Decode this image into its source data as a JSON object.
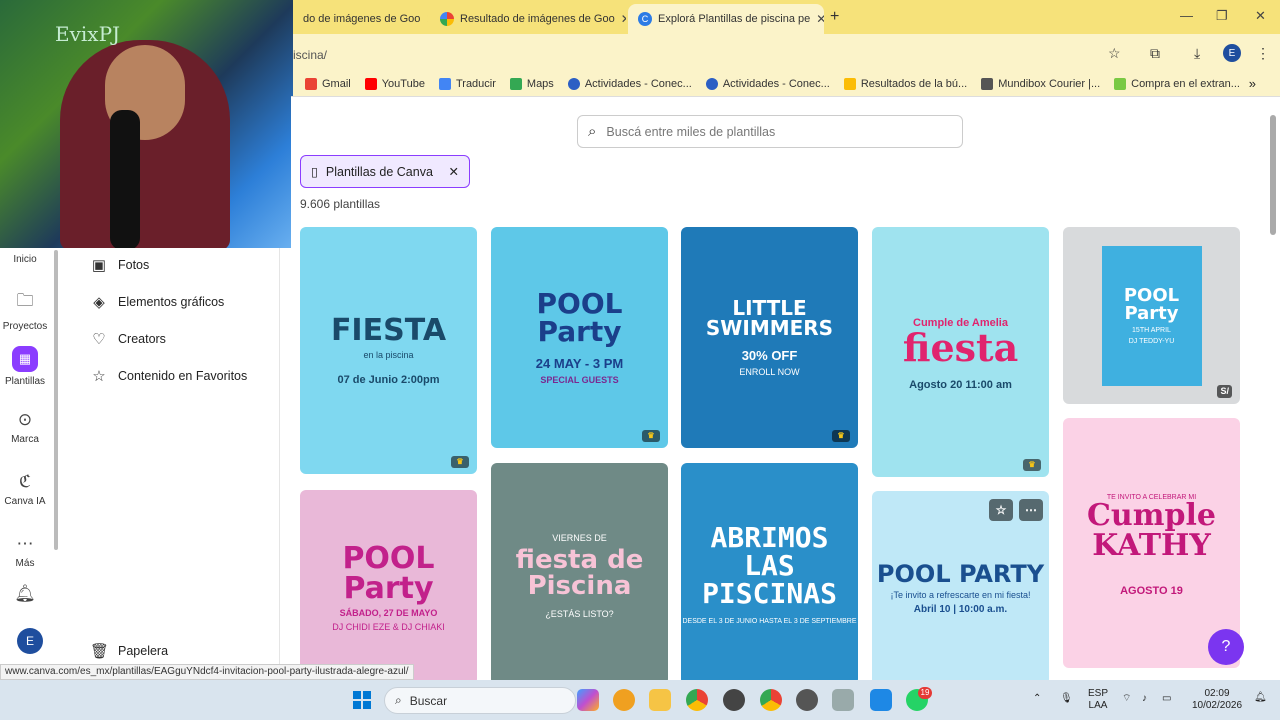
{
  "browser": {
    "tabs": [
      {
        "label": "do de imágenes de Goo",
        "icon": "google-icon"
      },
      {
        "label": "Resultado de imágenes de Goo",
        "icon": "google-icon"
      },
      {
        "label": "Explorá Plantillas de piscina pe",
        "icon": "canva-icon",
        "active": true
      }
    ],
    "new_tab": "+",
    "url": "iscina/",
    "bookmarks": [
      {
        "label": "Gmail",
        "color": "#ea4335"
      },
      {
        "label": "YouTube",
        "color": "#ff0000"
      },
      {
        "label": "Traducir",
        "color": "#4285f4"
      },
      {
        "label": "Maps",
        "color": "#34a853"
      },
      {
        "label": "Actividades - Conec...",
        "color": "#2c5fc4"
      },
      {
        "label": "Actividades - Conec...",
        "color": "#2c5fc4"
      },
      {
        "label": "Resultados de la bú...",
        "color": "#fbbc05"
      },
      {
        "label": "Mundibox Courier |...",
        "color": "#555555"
      },
      {
        "label": "Compra en el extran...",
        "color": "#7ac943"
      }
    ],
    "profile_initial": "E"
  },
  "webcam": {
    "overlay_text": "EvixPJ"
  },
  "rail": {
    "items": [
      {
        "label": "Inicio",
        "icon": "home-icon"
      },
      {
        "label": "Proyectos",
        "icon": "folder-icon"
      },
      {
        "label": "Plantillas",
        "icon": "templates-icon",
        "active": true
      },
      {
        "label": "Marca",
        "icon": "brand-icon"
      },
      {
        "label": "Canva IA",
        "icon": "canva-ai-icon"
      },
      {
        "label": "Más",
        "icon": "more-icon"
      }
    ],
    "user_initial": "E"
  },
  "sidemenu": {
    "items": [
      {
        "label": "Fotos",
        "icon": "photo-icon"
      },
      {
        "label": "Elementos gráficos",
        "icon": "shapes-icon"
      },
      {
        "label": "Creators",
        "icon": "creators-icon"
      },
      {
        "label": "Contenido en Favoritos",
        "icon": "star-icon"
      }
    ],
    "trash": "Papelera"
  },
  "main": {
    "search_placeholder": "Buscá entre miles de plantillas",
    "filter_chip": "Plantillas de Canva",
    "count": "9.606 plantillas",
    "cards": [
      {
        "title": "FIESTA",
        "sub": "en la piscina",
        "detail": "07 de Junio 2:00pm",
        "bg": "#7fd8f0",
        "fg": "#1a4a6a"
      },
      {
        "title": "POOL Party",
        "sub": "24 MAY - 3 PM",
        "detail": "SPECIAL GUESTS",
        "bg": "#5ec8e8",
        "fg": "#1b3f8a"
      },
      {
        "title": "LITTLE SWIMMERS",
        "sub": "30% OFF",
        "detail": "ENROLL NOW",
        "bg": "#1f7ab8",
        "fg": "#ffffff"
      },
      {
        "title": "fiesta",
        "sub": "Cumple de Amelia",
        "detail": "Agosto 20 11:00 am",
        "bg": "#9fe3ef",
        "fg": "#e0246e"
      },
      {
        "title": "POOL Party",
        "sub": "15TH APRIL",
        "detail": "DJ TEDDY-YU",
        "bg": "#d8dadc",
        "fg": "#ffffff",
        "price": "S/"
      },
      {
        "title": "POOL Party",
        "sub": "SÁBADO, 27 DE MAYO",
        "detail": "DJ CHIDI EZE & DJ CHIAKI",
        "bg": "#e9b8d8",
        "fg": "#c2218b"
      },
      {
        "title": "fiesta de Piscina",
        "sub": "VIERNES DE",
        "detail": "¿ESTÁS LISTO?",
        "bg": "#6f8a86",
        "fg": "#f7c3d6"
      },
      {
        "title": "ABRIMOS LAS PISCINAS",
        "sub": "DESDE EL 3 DE JUNIO HASTA EL 3 DE SEPTIEMBRE",
        "detail": "",
        "bg": "#2a8fc9",
        "fg": "#ffffff"
      },
      {
        "title": "POOL PARTY",
        "sub": "¡Te invito a refrescarte en mi fiesta!",
        "detail": "Abril 10 | 10:00 a.m.",
        "bg": "#bfe8f7",
        "fg": "#1a4f8f"
      },
      {
        "title": "Cumple KATHY",
        "sub": "TE INVITO A CELEBRAR MI",
        "detail": "AGOSTO 19",
        "bg": "#fbd2e6",
        "fg": "#c2187a"
      }
    ]
  },
  "status_url": "www.canva.com/es_mx/plantillas/EAGguYNdcf4-invitacion-pool-party-ilustrada-alegre-azul/",
  "taskbar": {
    "search_label": "Buscar",
    "lang_top": "ESP",
    "lang_bottom": "LAA",
    "time": "02:09",
    "date": "10/02/2026",
    "whatsapp_badge": "19"
  },
  "help": "?"
}
